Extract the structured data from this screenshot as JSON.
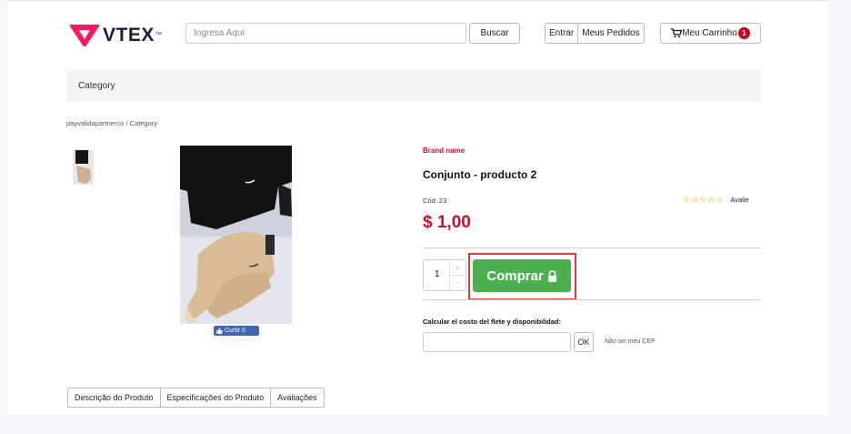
{
  "header": {
    "logo_text": "VTEX",
    "logo_tm": "™",
    "search_placeholder": "Ingresa Aquí",
    "search_button": "Buscar",
    "login_label": "Entrar",
    "orders_label": "Meus Pedidos",
    "cart_label": "Meu Carrinho",
    "cart_count": "1"
  },
  "category_bar": {
    "label": "Category"
  },
  "breadcrumb": {
    "text": "payvalidapartnerco  / Category"
  },
  "gallery": {
    "like_label": "Curtir 0"
  },
  "product": {
    "brand": "Brand name",
    "title": "Conjunto - producto 2",
    "sku": "Cód: 23",
    "review_label": "Avalie",
    "rating": 0,
    "rating_max": 5,
    "price": "$ 1,00",
    "quantity": "1",
    "qty_plus": "+",
    "qty_minus": "-",
    "buy_label": "Comprar"
  },
  "shipping": {
    "label": "Calcular el costo del flete y disponibilidad:",
    "ok_label": "OK",
    "unknown_cep": "Não sei meu CEP"
  },
  "tabs": [
    {
      "label": "Descrição do Produto"
    },
    {
      "label": "Especificações do Produto"
    },
    {
      "label": "Avaliações"
    }
  ],
  "colors": {
    "brand_red": "#c8102e",
    "buy_green": "#4caf50",
    "highlight_red": "#e53935",
    "logo_pink": "#f71963"
  }
}
